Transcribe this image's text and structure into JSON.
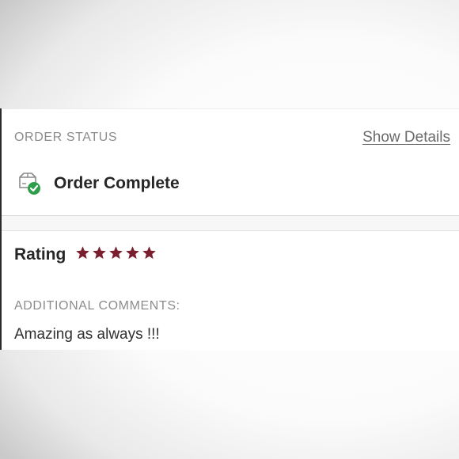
{
  "order": {
    "status_label": "ORDER STATUS",
    "show_details": "Show Details",
    "status": "Order Complete",
    "status_icon": "box-check-icon"
  },
  "rating": {
    "label": "Rating",
    "value": 5,
    "max": 5,
    "star_color": "#7a1f2d"
  },
  "comments": {
    "label": "ADDITIONAL COMMENTS:",
    "text": "Amazing as always !!!"
  }
}
